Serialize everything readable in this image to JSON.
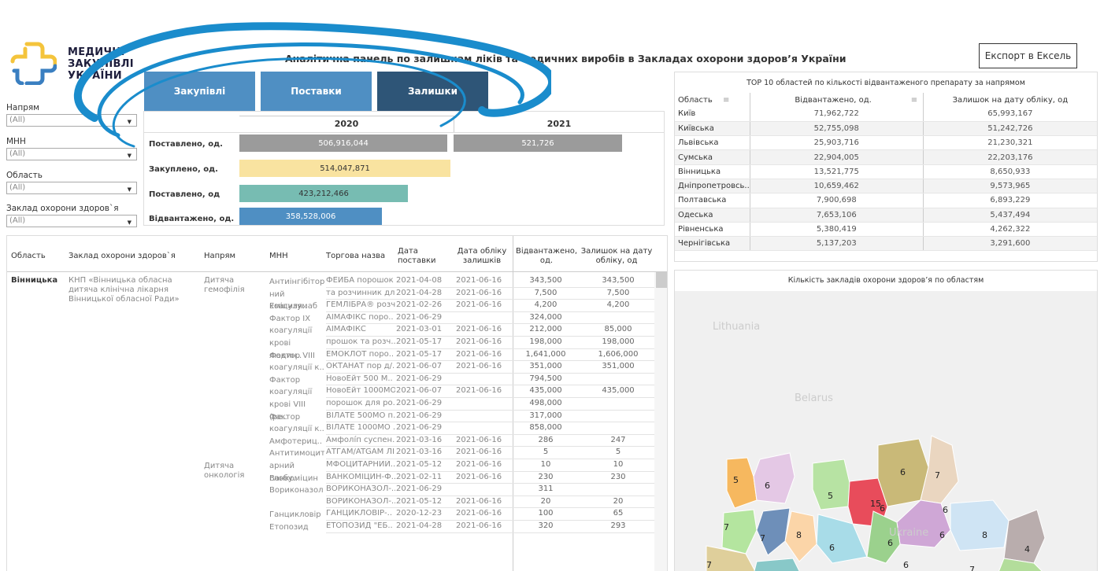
{
  "header": {
    "logo_lines": [
      "МЕДИЧНІ",
      "ЗАКУПІВЛІ",
      "УКРАЇНИ"
    ],
    "title": "Аналітична панель по залишкам ліків та медичних виробів в Закладах охорони здоров’я України",
    "export_label": "Експорт в Ексель"
  },
  "colors": {
    "tab_purchases": "#4f8fc3",
    "tab_supplies": "#4f8fc3",
    "tab_stock": "#2e5577",
    "bar_grey": "#9b9b9b",
    "bar_yellow": "#f9e3a0",
    "bar_teal": "#77bcb2",
    "bar_blue": "#4f8fc3",
    "swoosh": "#1a8ccc"
  },
  "filters": [
    {
      "label": "Напрям",
      "value": "(All)"
    },
    {
      "label": "МНН",
      "value": "(All)"
    },
    {
      "label": "Область",
      "value": "(All)"
    },
    {
      "label": "Заклад охорони здоров`я",
      "value": "(All)"
    }
  ],
  "tabs": [
    "Закупівлі",
    "Поставки",
    "Залишки"
  ],
  "summary": {
    "years": [
      "2020",
      "2021"
    ],
    "rows": [
      {
        "label": "Поставлено, од.",
        "values": [
          "506,916,044",
          "521,726"
        ]
      },
      {
        "label": "Закуплено, од.",
        "values": [
          "514,047,871",
          ""
        ]
      },
      {
        "label": "Поставлено, од",
        "values": [
          "423,212,466",
          ""
        ]
      },
      {
        "label": "Відвантажено, од.",
        "values": [
          "358,528,006",
          ""
        ]
      }
    ]
  },
  "top10": {
    "title": "ТОР 10 областей по кількості відвантаженого препарату за напрямом",
    "headers": [
      "Область",
      "Відвантажено, од.",
      "Залишок на дату обліку, од"
    ],
    "sort_icon": "≡",
    "rows": [
      [
        "Київ",
        "71,962,722",
        "65,993,167"
      ],
      [
        "Київська",
        "52,755,098",
        "51,242,726"
      ],
      [
        "Львівська",
        "25,903,716",
        "21,230,321"
      ],
      [
        "Сумська",
        "22,904,005",
        "22,203,176"
      ],
      [
        "Вінницька",
        "13,521,775",
        "8,650,933"
      ],
      [
        "Дніпропетровсь..",
        "10,659,462",
        "9,573,965"
      ],
      [
        "Полтавська",
        "7,900,698",
        "6,893,229"
      ],
      [
        "Одеська",
        "7,653,106",
        "5,437,494"
      ],
      [
        "Рівненська",
        "5,380,419",
        "4,262,322"
      ],
      [
        "Чернігівська",
        "5,137,203",
        "3,291,600"
      ]
    ]
  },
  "detail": {
    "headers": [
      "Область",
      "Заклад охорони здоров`я",
      "Напрям",
      "МНН",
      "Торгова назва",
      "Дата поставки",
      "Дата обліку залишків",
      "Відвантажено, од.",
      "Залишок на дату обліку, од"
    ],
    "region": "Вінницька",
    "facility": "КНП «Вінницька обласна дитяча клінічна лікарня Вінницької обласної Ради»",
    "directions": [
      "Дитяча гемофілія",
      "Дитяча онкологія"
    ],
    "inn": [
      "Антиінгібітор ний коагуля..",
      "Еміцизумаб",
      "Фактор IX коагуляції крові людин..",
      "Фактор VIII коагуляції к..",
      "Фактор коагуляції крові VIII (ре..",
      "Фактор коагуляції к..",
      "Амфотериц..",
      "Антитимоцит арний глобу..",
      "Ванкоміцин",
      "Вориконазол",
      "Ганцикловір",
      "Етопозид"
    ],
    "rows": [
      [
        "ФЕЙБА порошок",
        "2021-04-08",
        "2021-06-16",
        "343,500",
        "343,500"
      ],
      [
        "та розчинник дл..",
        "2021-04-28",
        "2021-06-16",
        "7,500",
        "7,500"
      ],
      [
        "ГЕМЛІБРА® розч..",
        "2021-02-26",
        "2021-06-16",
        "4,200",
        "4,200"
      ],
      [
        "АІМАФІКС поро..",
        "2021-06-29",
        "",
        "324,000",
        ""
      ],
      [
        "АІМАФІКС",
        "2021-03-01",
        "2021-06-16",
        "212,000",
        "85,000"
      ],
      [
        "прошок та розч..",
        "2021-05-17",
        "2021-06-16",
        "198,000",
        "198,000"
      ],
      [
        "ЕМОКЛОТ поро..",
        "2021-05-17",
        "2021-06-16",
        "1,641,000",
        "1,606,000"
      ],
      [
        "ОКТАНАТ пор д/..",
        "2021-06-07",
        "2021-06-16",
        "351,000",
        "351,000"
      ],
      [
        "НовоЕйт 500 М..",
        "2021-06-29",
        "",
        "794,500",
        ""
      ],
      [
        "НовоЕйт 1000МО",
        "2021-06-07",
        "2021-06-16",
        "435,000",
        "435,000"
      ],
      [
        "порошок для ро..",
        "2021-06-29",
        "",
        "498,000",
        ""
      ],
      [
        "ВІЛАТЕ 500МО п..",
        "2021-06-29",
        "",
        "317,000",
        ""
      ],
      [
        "ВІЛАТЕ 1000МО ..",
        "2021-06-29",
        "",
        "858,000",
        ""
      ],
      [
        "Амфолі́п суспен..",
        "2021-03-16",
        "2021-06-16",
        "286",
        "247"
      ],
      [
        "АТГАМ/ATGAM ЛІ",
        "2021-03-16",
        "2021-06-16",
        "5",
        "5"
      ],
      [
        "МФОЦИТАРНИЙ..",
        "2021-05-12",
        "2021-06-16",
        "10",
        "10"
      ],
      [
        "ВАНКОМІЦИН-Ф..",
        "2021-02-11",
        "2021-06-16",
        "230",
        "230"
      ],
      [
        "ВОРИКОНАЗОЛ-..",
        "2021-06-29",
        "",
        "311",
        ""
      ],
      [
        "ВОРИКОНАЗОЛ-..",
        "2021-05-12",
        "2021-06-16",
        "20",
        "20"
      ],
      [
        "ГАНЦИКЛОВІР-..",
        "2020-12-23",
        "2021-06-16",
        "100",
        "65"
      ],
      [
        "ЕТОПОЗИД \"ЕБ..",
        "2021-04-28",
        "2021-06-16",
        "320",
        "293"
      ]
    ]
  },
  "map": {
    "title": "Кількість закладів охорони здоров’я по областям",
    "countries": [
      "Lithuania",
      "Belarus",
      "Ukraine"
    ],
    "counts": [
      "5",
      "6",
      "5",
      "15",
      "6",
      "7",
      "6",
      "7",
      "7",
      "8",
      "6",
      "6",
      "6",
      "8",
      "4",
      "6",
      "7",
      "6",
      "7"
    ]
  }
}
